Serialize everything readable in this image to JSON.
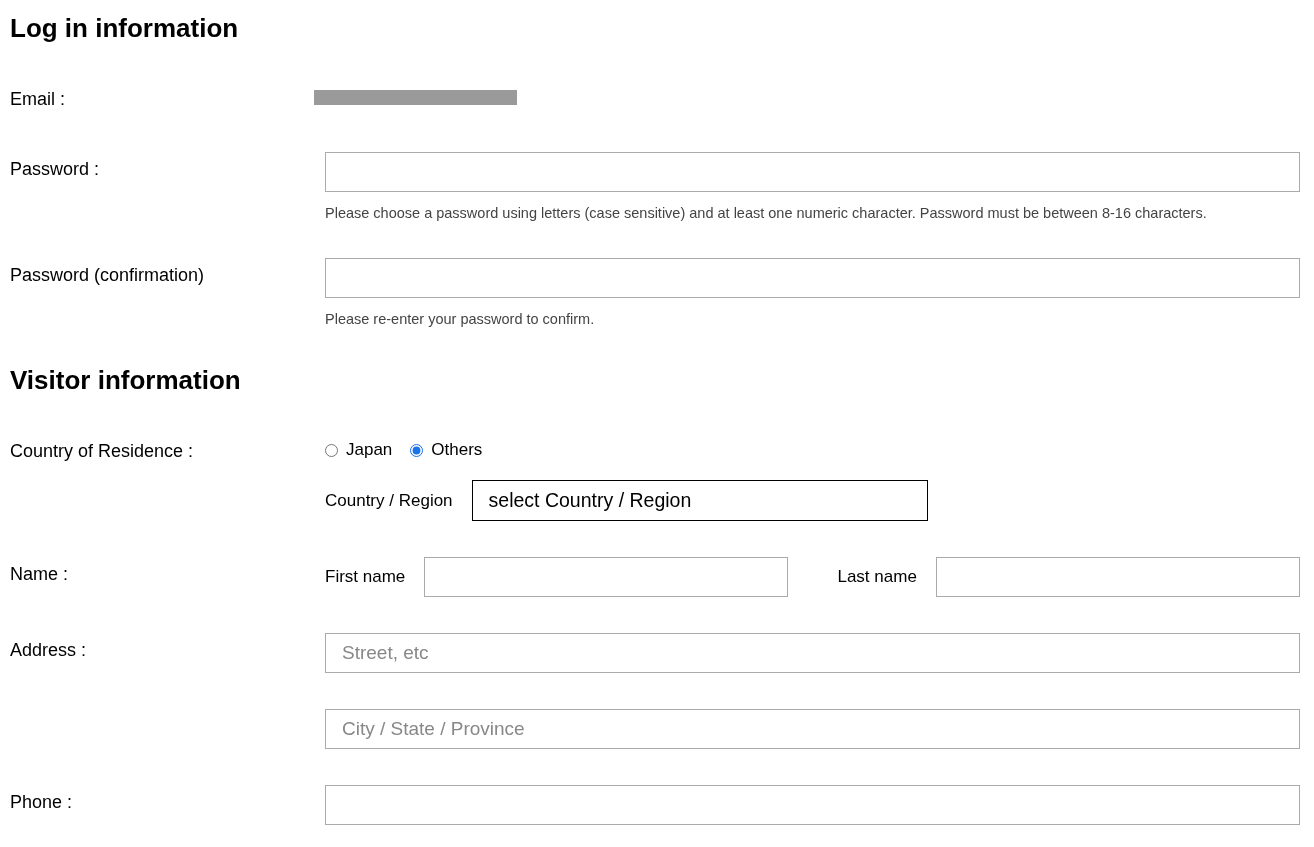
{
  "sections": [
    {
      "title": "Log in information",
      "rows": [
        {
          "kind": "text",
          "label": "Email :",
          "redacted": true
        },
        {
          "kind": "input",
          "label": "Password :",
          "hint": "Please choose a password using letters (case sensitive) and at least one numeric character. Password must be between 8-16 characters."
        },
        {
          "kind": "input",
          "label": "Password (confirmation)",
          "hint": "Please re-enter your password to confirm."
        }
      ]
    },
    {
      "title": "Visitor information",
      "rows": [
        {
          "kind": "choice",
          "label": "Country of Residence :",
          "options": [
            {
              "label": "Japan",
              "selected": false
            },
            {
              "label": "Others",
              "selected": true
            }
          ],
          "select": {
            "label": "Country / Region",
            "value": "select Country / Region"
          }
        },
        {
          "kind": "name",
          "label": "Name :",
          "parts": [
            {
              "label": "First name"
            },
            {
              "label": "Last name"
            }
          ]
        },
        {
          "kind": "inputs",
          "label": "Address :",
          "fields": [
            {
              "placeholder": "Street, etc"
            },
            {
              "placeholder": "City / State / Province"
            }
          ]
        },
        {
          "kind": "input",
          "label": "Phone :"
        }
      ]
    }
  ]
}
